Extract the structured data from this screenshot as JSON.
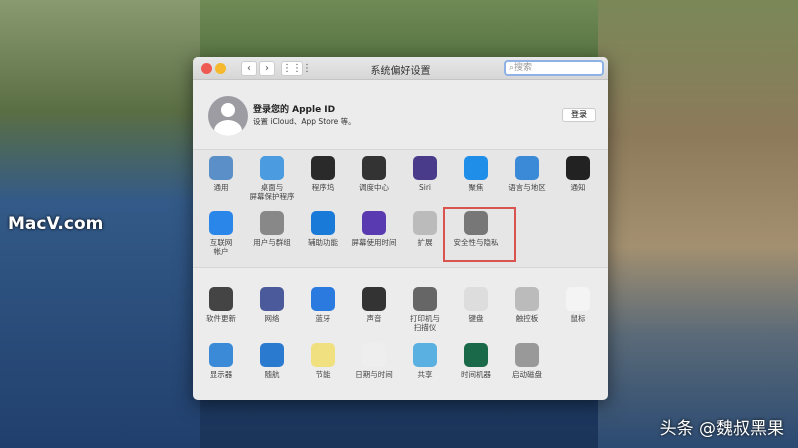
{
  "overlay": {
    "logo": "MacV.com",
    "credit": "头条 @魏叔黑果"
  },
  "window": {
    "title": "系统偏好设置",
    "search_placeholder": "搜索",
    "back": "‹",
    "forward": "›",
    "grid": "⋮⋮⋮"
  },
  "apple_id": {
    "title": "登录您的 Apple ID",
    "subtitle": "设置 iCloud、App Store 等。",
    "login_button": "登录"
  },
  "row1": [
    {
      "label": "通用",
      "icon": "general-icon",
      "color": "#5b8fc7"
    },
    {
      "label": "桌面与\n屏幕保护程序",
      "icon": "desktop-icon",
      "color": "#4a9be0"
    },
    {
      "label": "程序坞",
      "icon": "dock-icon",
      "color": "#2a2a2a"
    },
    {
      "label": "调度中心",
      "icon": "mission-control-icon",
      "color": "#333"
    },
    {
      "label": "Siri",
      "icon": "siri-icon",
      "color": "#4a3a8a"
    },
    {
      "label": "聚焦",
      "icon": "spotlight-icon",
      "color": "#1e8ee8"
    },
    {
      "label": "语言与地区",
      "icon": "language-icon",
      "color": "#3a8ad8"
    },
    {
      "label": "通知",
      "icon": "notifications-icon",
      "color": "#222"
    }
  ],
  "row2": [
    {
      "label": "互联网\n帐户",
      "icon": "internet-accounts-icon",
      "color": "#2a86e8"
    },
    {
      "label": "用户与群组",
      "icon": "users-icon",
      "color": "#888"
    },
    {
      "label": "辅助功能",
      "icon": "accessibility-icon",
      "color": "#1a7ad8"
    },
    {
      "label": "屏幕使用时间",
      "icon": "screen-time-icon",
      "color": "#5a3ab0"
    },
    {
      "label": "扩展",
      "icon": "extensions-icon",
      "color": "#bbb"
    },
    {
      "label": "安全性与隐私",
      "icon": "security-icon",
      "color": "#777"
    }
  ],
  "row3": [
    {
      "label": "软件更新",
      "icon": "software-update-icon",
      "color": "#444"
    },
    {
      "label": "网络",
      "icon": "network-icon",
      "color": "#4a5a9a"
    },
    {
      "label": "蓝牙",
      "icon": "bluetooth-icon",
      "color": "#2a7ae0"
    },
    {
      "label": "声音",
      "icon": "sound-icon",
      "color": "#333"
    },
    {
      "label": "打印机与\n扫描仪",
      "icon": "printer-icon",
      "color": "#666"
    },
    {
      "label": "键盘",
      "icon": "keyboard-icon",
      "color": "#ddd"
    },
    {
      "label": "触控板",
      "icon": "trackpad-icon",
      "color": "#bbb"
    },
    {
      "label": "鼠标",
      "icon": "mouse-icon",
      "color": "#f4f4f4"
    }
  ],
  "row4": [
    {
      "label": "显示器",
      "icon": "displays-icon",
      "color": "#3a8ad8"
    },
    {
      "label": "随航",
      "icon": "sidecar-icon",
      "color": "#2a7ad0"
    },
    {
      "label": "节能",
      "icon": "energy-saver-icon",
      "color": "#f0e080"
    },
    {
      "label": "日期与时间",
      "icon": "date-time-icon",
      "color": "#eee"
    },
    {
      "label": "共享",
      "icon": "sharing-icon",
      "color": "#5ab0e0"
    },
    {
      "label": "时间机器",
      "icon": "time-machine-icon",
      "color": "#1a6a4a"
    },
    {
      "label": "启动磁盘",
      "icon": "startup-disk-icon",
      "color": "#999"
    }
  ]
}
